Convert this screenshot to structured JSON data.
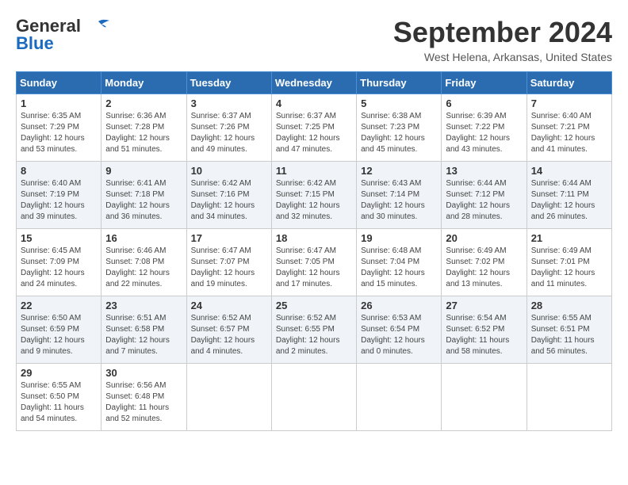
{
  "header": {
    "logo_general": "General",
    "logo_blue": "Blue",
    "month_title": "September 2024",
    "location": "West Helena, Arkansas, United States"
  },
  "days_of_week": [
    "Sunday",
    "Monday",
    "Tuesday",
    "Wednesday",
    "Thursday",
    "Friday",
    "Saturday"
  ],
  "weeks": [
    [
      {
        "day": "1",
        "sunrise": "6:35 AM",
        "sunset": "7:29 PM",
        "daylight": "12 hours and 53 minutes."
      },
      {
        "day": "2",
        "sunrise": "6:36 AM",
        "sunset": "7:28 PM",
        "daylight": "12 hours and 51 minutes."
      },
      {
        "day": "3",
        "sunrise": "6:37 AM",
        "sunset": "7:26 PM",
        "daylight": "12 hours and 49 minutes."
      },
      {
        "day": "4",
        "sunrise": "6:37 AM",
        "sunset": "7:25 PM",
        "daylight": "12 hours and 47 minutes."
      },
      {
        "day": "5",
        "sunrise": "6:38 AM",
        "sunset": "7:23 PM",
        "daylight": "12 hours and 45 minutes."
      },
      {
        "day": "6",
        "sunrise": "6:39 AM",
        "sunset": "7:22 PM",
        "daylight": "12 hours and 43 minutes."
      },
      {
        "day": "7",
        "sunrise": "6:40 AM",
        "sunset": "7:21 PM",
        "daylight": "12 hours and 41 minutes."
      }
    ],
    [
      {
        "day": "8",
        "sunrise": "6:40 AM",
        "sunset": "7:19 PM",
        "daylight": "12 hours and 39 minutes."
      },
      {
        "day": "9",
        "sunrise": "6:41 AM",
        "sunset": "7:18 PM",
        "daylight": "12 hours and 36 minutes."
      },
      {
        "day": "10",
        "sunrise": "6:42 AM",
        "sunset": "7:16 PM",
        "daylight": "12 hours and 34 minutes."
      },
      {
        "day": "11",
        "sunrise": "6:42 AM",
        "sunset": "7:15 PM",
        "daylight": "12 hours and 32 minutes."
      },
      {
        "day": "12",
        "sunrise": "6:43 AM",
        "sunset": "7:14 PM",
        "daylight": "12 hours and 30 minutes."
      },
      {
        "day": "13",
        "sunrise": "6:44 AM",
        "sunset": "7:12 PM",
        "daylight": "12 hours and 28 minutes."
      },
      {
        "day": "14",
        "sunrise": "6:44 AM",
        "sunset": "7:11 PM",
        "daylight": "12 hours and 26 minutes."
      }
    ],
    [
      {
        "day": "15",
        "sunrise": "6:45 AM",
        "sunset": "7:09 PM",
        "daylight": "12 hours and 24 minutes."
      },
      {
        "day": "16",
        "sunrise": "6:46 AM",
        "sunset": "7:08 PM",
        "daylight": "12 hours and 22 minutes."
      },
      {
        "day": "17",
        "sunrise": "6:47 AM",
        "sunset": "7:07 PM",
        "daylight": "12 hours and 19 minutes."
      },
      {
        "day": "18",
        "sunrise": "6:47 AM",
        "sunset": "7:05 PM",
        "daylight": "12 hours and 17 minutes."
      },
      {
        "day": "19",
        "sunrise": "6:48 AM",
        "sunset": "7:04 PM",
        "daylight": "12 hours and 15 minutes."
      },
      {
        "day": "20",
        "sunrise": "6:49 AM",
        "sunset": "7:02 PM",
        "daylight": "12 hours and 13 minutes."
      },
      {
        "day": "21",
        "sunrise": "6:49 AM",
        "sunset": "7:01 PM",
        "daylight": "12 hours and 11 minutes."
      }
    ],
    [
      {
        "day": "22",
        "sunrise": "6:50 AM",
        "sunset": "6:59 PM",
        "daylight": "12 hours and 9 minutes."
      },
      {
        "day": "23",
        "sunrise": "6:51 AM",
        "sunset": "6:58 PM",
        "daylight": "12 hours and 7 minutes."
      },
      {
        "day": "24",
        "sunrise": "6:52 AM",
        "sunset": "6:57 PM",
        "daylight": "12 hours and 4 minutes."
      },
      {
        "day": "25",
        "sunrise": "6:52 AM",
        "sunset": "6:55 PM",
        "daylight": "12 hours and 2 minutes."
      },
      {
        "day": "26",
        "sunrise": "6:53 AM",
        "sunset": "6:54 PM",
        "daylight": "12 hours and 0 minutes."
      },
      {
        "day": "27",
        "sunrise": "6:54 AM",
        "sunset": "6:52 PM",
        "daylight": "11 hours and 58 minutes."
      },
      {
        "day": "28",
        "sunrise": "6:55 AM",
        "sunset": "6:51 PM",
        "daylight": "11 hours and 56 minutes."
      }
    ],
    [
      {
        "day": "29",
        "sunrise": "6:55 AM",
        "sunset": "6:50 PM",
        "daylight": "11 hours and 54 minutes."
      },
      {
        "day": "30",
        "sunrise": "6:56 AM",
        "sunset": "6:48 PM",
        "daylight": "11 hours and 52 minutes."
      },
      null,
      null,
      null,
      null,
      null
    ]
  ]
}
